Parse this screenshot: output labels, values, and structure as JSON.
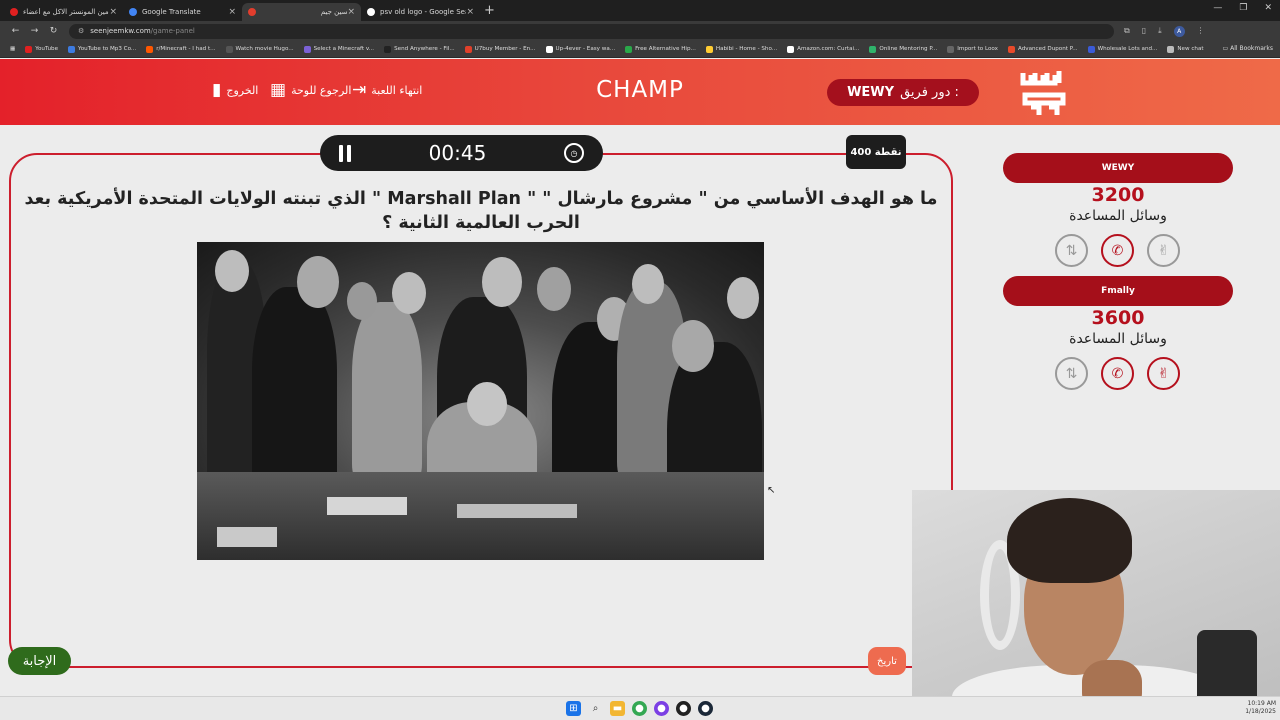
{
  "browser": {
    "tabs": [
      {
        "title": "مين المونستر الاكل مع أعضاء Cube...",
        "fav": "#e02020"
      },
      {
        "title": "Google Translate",
        "fav": "#4285f4"
      },
      {
        "title": "سين جيم",
        "fav": "#e23d2d"
      },
      {
        "title": "psv old logo - Google Search",
        "fav": "#ffffff"
      }
    ],
    "url_host": "seenjeemkw.com",
    "url_path": "/game-panel",
    "profile_initial": "A",
    "bookmarks": [
      {
        "label": "YouTube",
        "color": "#e02020"
      },
      {
        "label": "YouTube to Mp3 Co...",
        "color": "#3d7be0"
      },
      {
        "label": "r/Minecraft - I had t...",
        "color": "#ff5700"
      },
      {
        "label": "Watch movie Hugo...",
        "color": "#333333"
      },
      {
        "label": "Select a Minecraft v...",
        "color": "#7b61d6"
      },
      {
        "label": "Send Anywhere - Fil...",
        "color": "#222222"
      },
      {
        "label": "U7buy Member - En...",
        "color": "#e0402a"
      },
      {
        "label": "Up-4ever - Easy wa...",
        "color": "#ffffff"
      },
      {
        "label": "Free Alternative Hip...",
        "color": "#2aa84a"
      },
      {
        "label": "Habibi - Home - Sho...",
        "color": "#ffcc33"
      },
      {
        "label": "Amazon.com: Curtai...",
        "color": "#ffffff"
      },
      {
        "label": "Online Mentoring P...",
        "color": "#2fb36b"
      },
      {
        "label": "Import to Loox",
        "color": "#444444"
      },
      {
        "label": "Advanced Dupont P...",
        "color": "#e84a2a"
      },
      {
        "label": "Wholesale Lots and...",
        "color": "#3b5bd6"
      },
      {
        "label": "New chat",
        "color": "#bbbbbb"
      }
    ],
    "all_bookmarks": "All Bookmarks"
  },
  "header": {
    "exit_label": "الخروج",
    "board_label": "الرجوع للوحة",
    "end_game_label": "انتهاء اللعبة",
    "game_name": "CHAMP",
    "turn_prefix": "دور فريق :",
    "turn_team": "WEWY",
    "logo_text": "سين جيم"
  },
  "question_panel": {
    "timer": "00:45",
    "points": "400 نقطة",
    "question": "ما هو الهدف الأساسي من \" مشروع مارشال \" \" Marshall Plan \" الذي تبنته الولايات المتحدة الأمريكية بعد الحرب العالمية الثانية ؟",
    "answer_label": "الإجابة",
    "category_label": "تاريخ"
  },
  "teams": [
    {
      "name": "WEWY",
      "score": "3200",
      "aids_label": "وسائل المساعدة",
      "aids": [
        {
          "icon": "swap-icon",
          "used": true
        },
        {
          "icon": "phone-icon",
          "used": false
        },
        {
          "icon": "two-fingers-icon",
          "used": true
        }
      ]
    },
    {
      "name": "Fmally",
      "score": "3600",
      "aids_label": "وسائل المساعدة",
      "aids": [
        {
          "icon": "swap-icon",
          "used": true
        },
        {
          "icon": "phone-icon",
          "used": false
        },
        {
          "icon": "two-fingers-icon",
          "used": false
        }
      ]
    }
  ],
  "taskbar": {
    "time": "10:19 AM",
    "date": "1/18/2025"
  }
}
